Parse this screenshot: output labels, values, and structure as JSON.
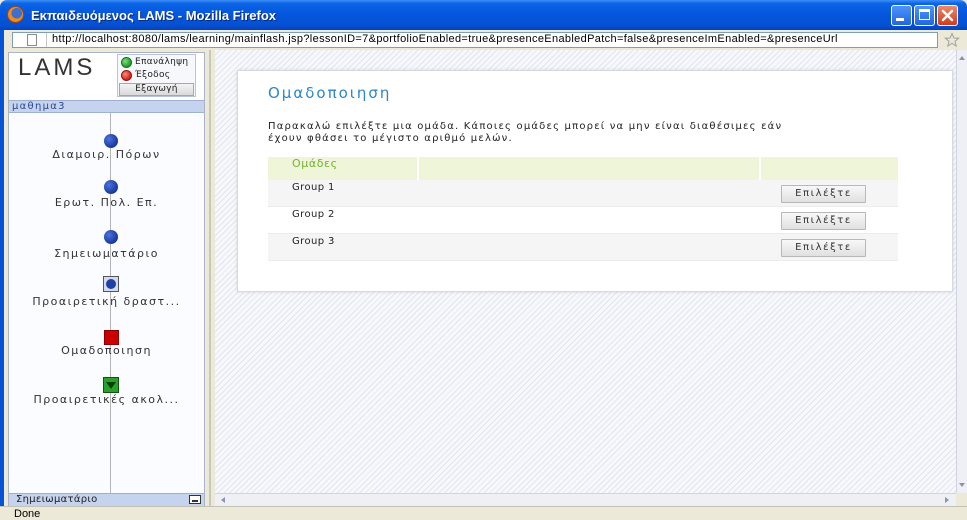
{
  "window": {
    "title": "Εκπαιδευόμενος LAMS - Mozilla Firefox",
    "icon": "firefox-icon"
  },
  "browser": {
    "url": "http://localhost:8080/lams/learning/mainflash.jsp?lessonID=7&portfolioEnabled=true&presenceEnabledPatch=false&presenceImEnabled=&presenceUrl",
    "status": "Done",
    "bookmark_icon": "star-outline-icon"
  },
  "learner_panel": {
    "logo_text": "LAMS",
    "resume_label": "Επανάληψη",
    "resume_icon": "green-circle-icon",
    "exit_label": "Έξοδος",
    "exit_icon": "red-circle-icon",
    "export_label": "Εξαγωγή",
    "lesson_name": "μαθημα3",
    "activities": [
      {
        "label": "Διαμοιρ. Πόρων",
        "icon": "blue-circle-icon"
      },
      {
        "label": "Ερωτ. Πολ. Επ.",
        "icon": "blue-circle-icon"
      },
      {
        "label": "Σημειωματάριο",
        "icon": "blue-circle-icon"
      },
      {
        "label": "Προαιρετική δραστ...",
        "icon": "boxed-blue-circle-icon"
      },
      {
        "label": "Ομαδοποιηση",
        "icon": "red-square-icon"
      },
      {
        "label": "Προαιρετικές ακολ...",
        "icon": "green-square-down-arrow-icon"
      }
    ],
    "notebook_label": "Σημειωματάριο"
  },
  "grouping": {
    "title": "Ομαδοποιηση",
    "instructions": [
      "Παρακαλώ επιλέξτε μια ομάδα. Κάποιες ομάδες μπορεί να μην είναι διαθέσιμες εάν",
      "έχουν φθάσει το μέγιστο αριθμό μελών."
    ],
    "column_header": "Ομάδες",
    "groups": [
      {
        "name": "Group 1",
        "button_label": "Επιλέξτε"
      },
      {
        "name": "Group 2",
        "button_label": "Επιλέξτε"
      },
      {
        "name": "Group 3",
        "button_label": "Επιλέξτε"
      }
    ]
  },
  "colors": {
    "titlebar": "#0556dc",
    "heading": "#2e86c9",
    "table_header_bg": "#eef5d9",
    "table_header_text": "#78b02e",
    "completed_activity": "#1f3fa8",
    "current_activity": "#cc0000",
    "optional_sequence": "#2aa12a",
    "lesson_bar": "#c5d3ee"
  }
}
